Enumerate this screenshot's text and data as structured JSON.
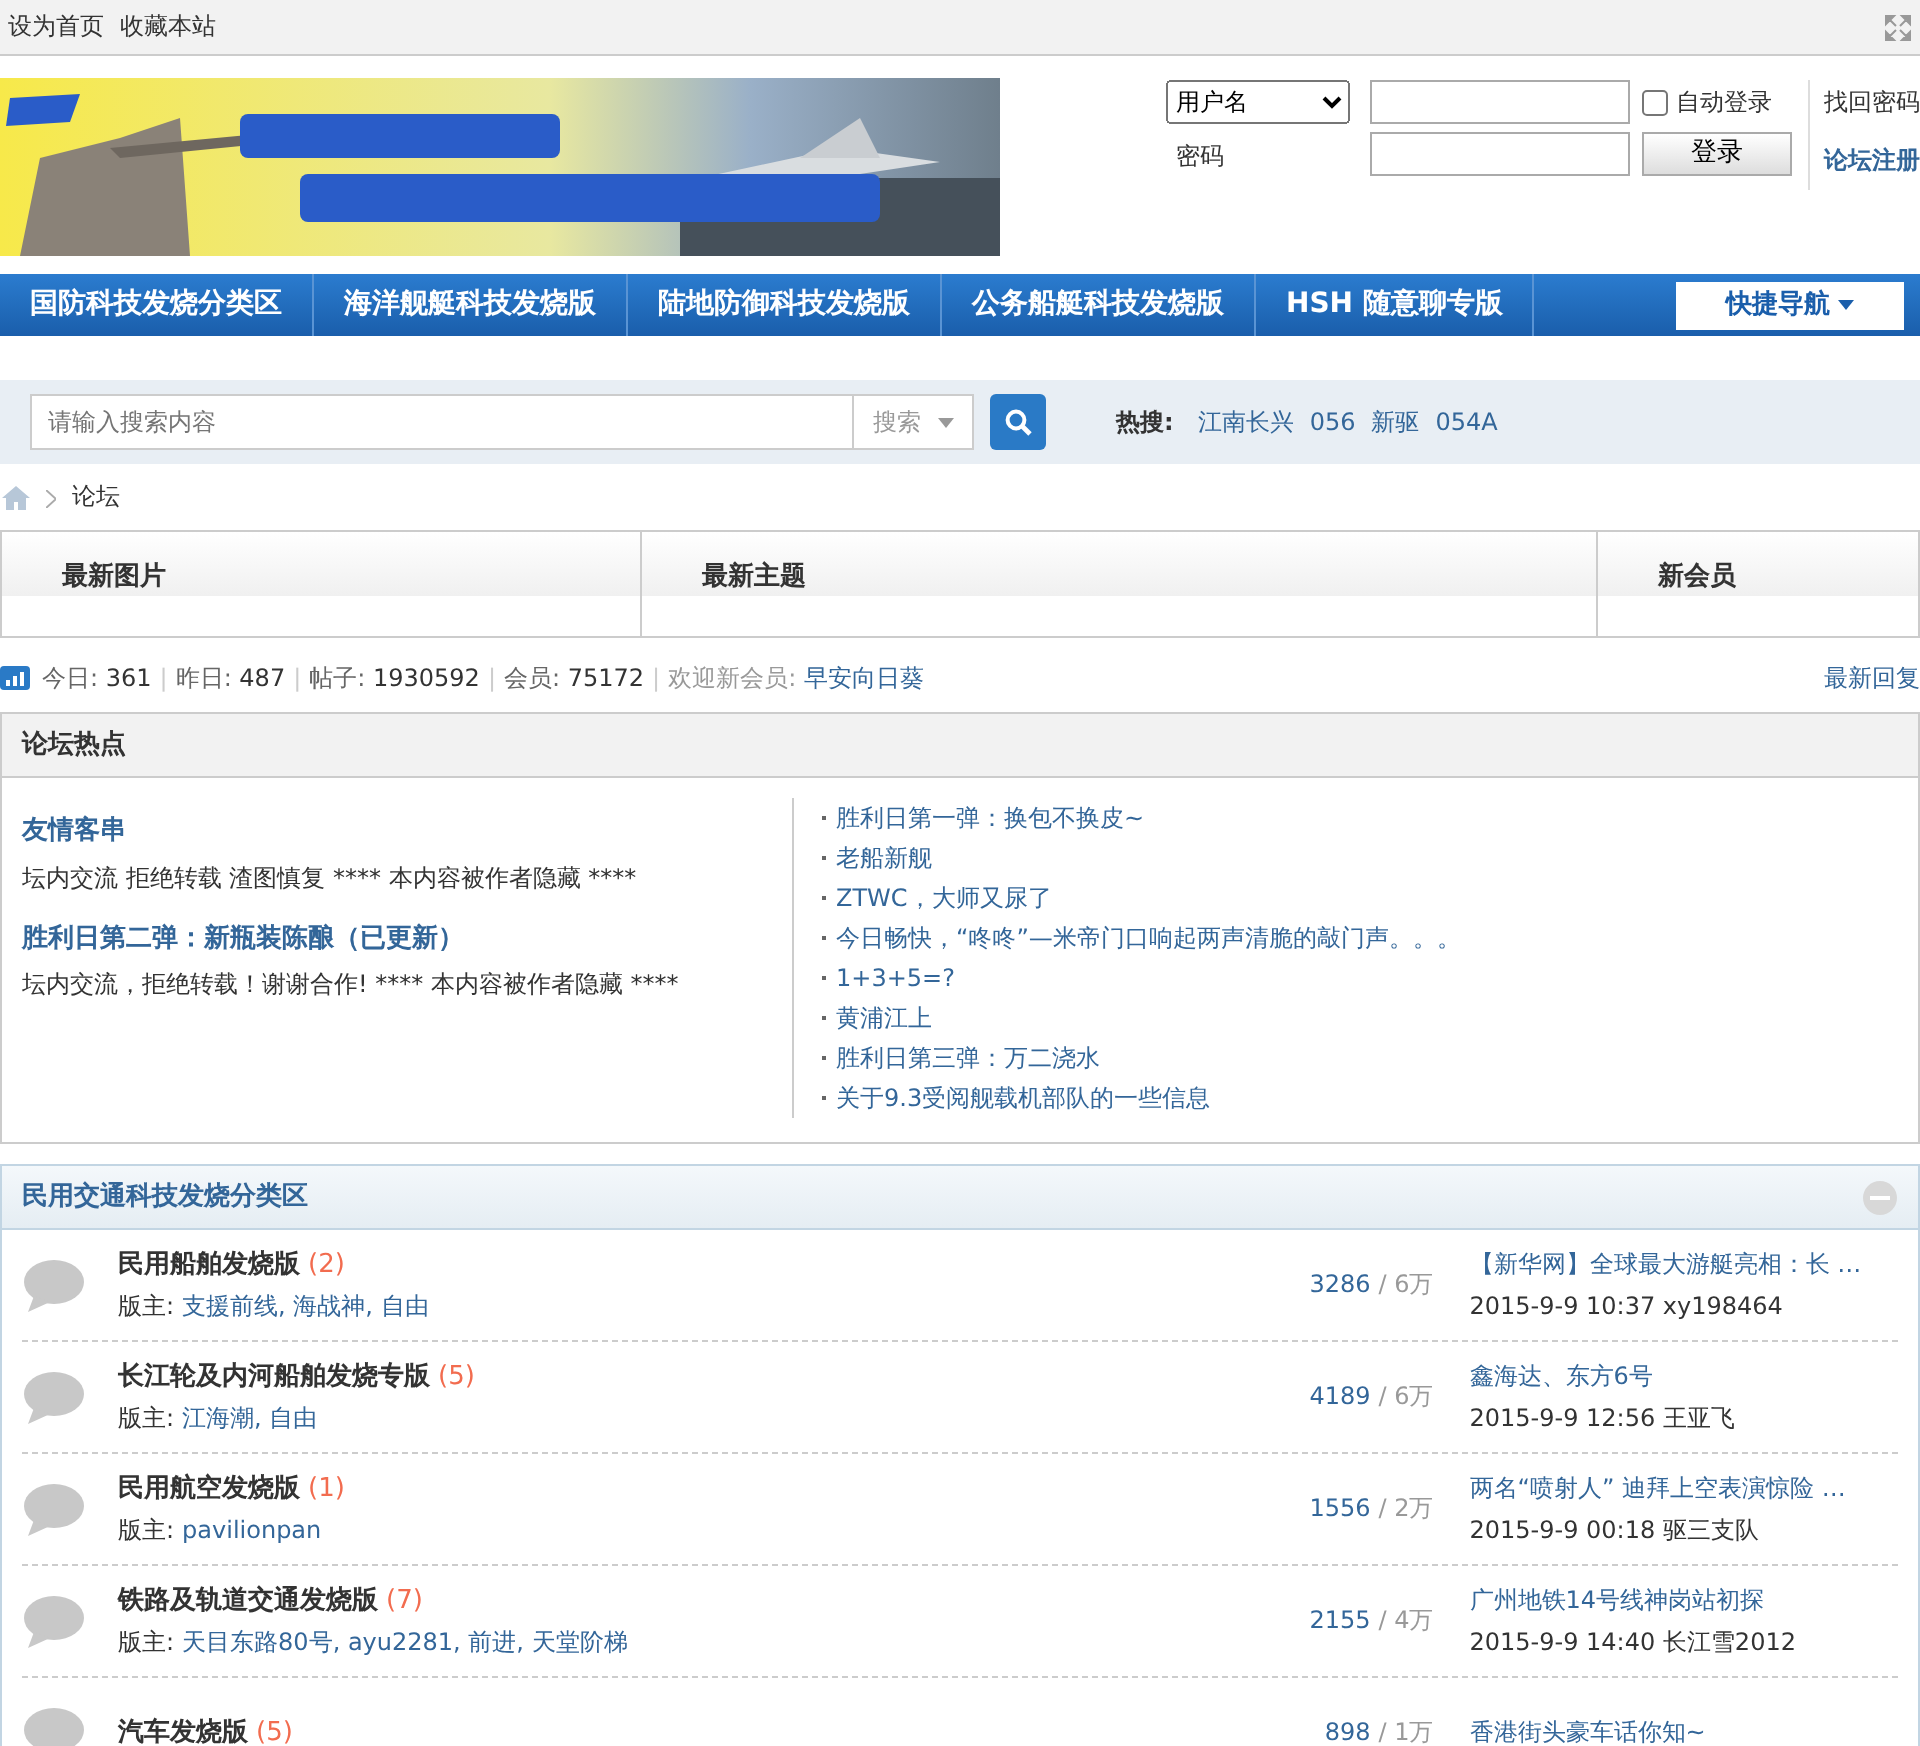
{
  "topbar": {
    "links": [
      "设为首页",
      "收藏本站"
    ]
  },
  "banner": {
    "kind": "picture"
  },
  "login": {
    "account_type": "用户名",
    "password_label": "密码",
    "auto_login": {
      "label": "自动登录",
      "checked": false
    },
    "submit": "登录",
    "forgot": "找回密码",
    "register": "论坛注册"
  },
  "nav": {
    "items": [
      "国防科技发烧分类区",
      "海洋舰艇科技发烧版",
      "陆地防御科技发烧版",
      "公务船艇科技发烧版",
      "HSH 随意聊专版"
    ],
    "quick": "快捷导航"
  },
  "search": {
    "placeholder": "请输入搜索内容",
    "scope": "搜索",
    "hot_label": "热搜:",
    "hot": [
      "江南长兴",
      "056",
      "新驱",
      "054A"
    ]
  },
  "breadcrumb": [
    "论坛"
  ],
  "tabs": [
    "最新图片",
    "最新主题",
    "新会员"
  ],
  "stats": [
    {
      "label": "今日:",
      "value": "361",
      "separator": "|"
    },
    {
      "label": "昨日:",
      "value": "487",
      "separator": "|"
    },
    {
      "label": "帖子:",
      "value": "1930592",
      "separator": "|"
    },
    {
      "label": "会员:",
      "value": "75172",
      "separator": "|"
    }
  ],
  "welcome": {
    "label": "欢迎新会员:",
    "name": "早安向日葵"
  },
  "latest_link": "最新回复",
  "hot_box": {
    "title": "论坛热点",
    "features": [
      {
        "title": "友情客串",
        "summary": "坛内交流 拒绝转载 渣图慎复 **** 本内容被作者隐藏 ****"
      },
      {
        "title": "胜利日第二弹：新瓶装陈酿（已更新）",
        "summary": "坛内交流，拒绝转载！谢谢合作! **** 本内容被作者隐藏 ****"
      }
    ],
    "links": [
      "胜利日第一弹：换包不换皮~",
      "老船新舰",
      "ZTWC，大师又尿了",
      "今日畅快，“咚咚”—米帝门口响起两声清脆的敲门声。。。",
      "1+3+5=?",
      "黄浦江上",
      "胜利日第三弹：万二浇水",
      "关于9.3受阅舰载机部队的一些信息"
    ]
  },
  "category": {
    "title": "民用交通科技发烧分类区",
    "expanded": true,
    "forums": [
      {
        "name": "民用船舶发烧版",
        "today": "(2)",
        "moderator_label": "版主:",
        "moderators": "支援前线, 海战神, 自由",
        "threads": "3286",
        "posts": "/ 6万",
        "last_title": "【新华网】全球最大游艇亮相：长 …",
        "last_meta": "2015-9-9 10:37 xy198464"
      },
      {
        "name": "长江轮及内河船舶发烧专版",
        "today": "(5)",
        "moderator_label": "版主:",
        "moderators": "江海潮, 自由",
        "threads": "4189",
        "posts": "/ 6万",
        "last_title": "鑫海达、东方6号",
        "last_meta": "2015-9-9 12:56 王亚飞"
      },
      {
        "name": "民用航空发烧版",
        "today": "(1)",
        "moderator_label": "版主:",
        "moderators": "pavilionpan",
        "threads": "1556",
        "posts": "/ 2万",
        "last_title": "两名“喷射人” 迪拜上空表演惊险 …",
        "last_meta": "2015-9-9 00:18 驱三支队"
      },
      {
        "name": "铁路及轨道交通发烧版",
        "today": "(7)",
        "moderator_label": "版主:",
        "moderators": "天目东路80号, ayu2281, 前进, 天堂阶梯",
        "threads": "2155",
        "posts": "/ 4万",
        "last_title": "广州地铁14号线神岗站初探",
        "last_meta": "2015-9-9 14:40 长江雪2012"
      },
      {
        "name": "汽车发烧版",
        "today": "(5)",
        "threads": "898",
        "posts": "/ 1万",
        "last_title": "香港街头豪车话你知~"
      }
    ]
  }
}
